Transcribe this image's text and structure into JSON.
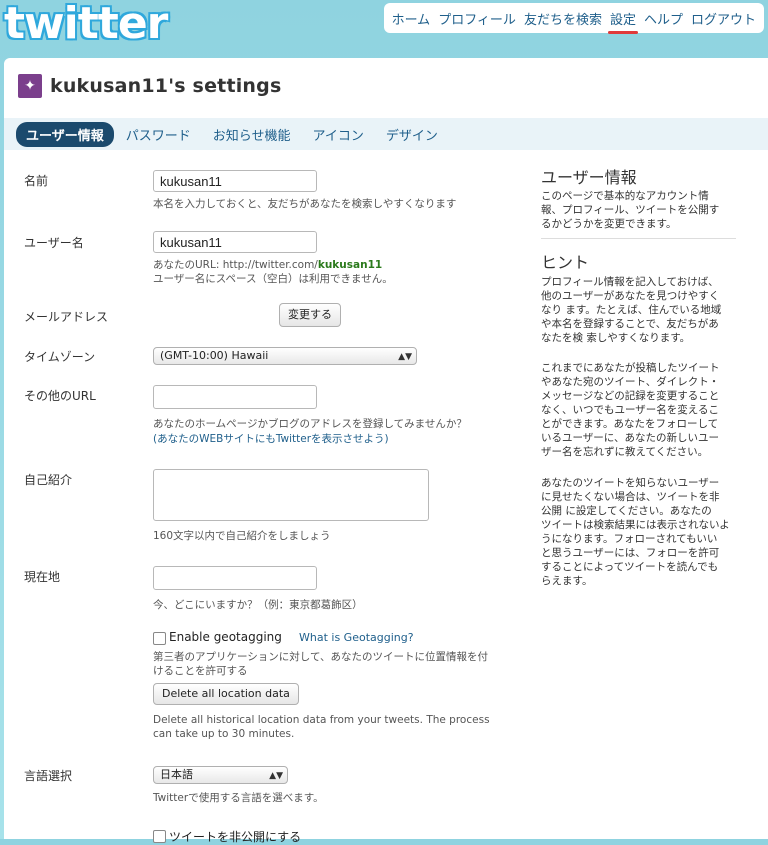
{
  "header": {
    "logo": "twitter",
    "nav": [
      "ホーム",
      "プロフィール",
      "友だちを検索",
      "設定",
      "ヘルプ",
      "ログアウト"
    ]
  },
  "page": {
    "title": "kukusan11's settings",
    "tabs": [
      "ユーザー情報",
      "パスワード",
      "お知らせ機能",
      "アイコン",
      "デザイン"
    ]
  },
  "form": {
    "name": {
      "label": "名前",
      "value": "kukusan11",
      "hint": "本名を入力しておくと、友だちがあなたを検索しやすくなります"
    },
    "username": {
      "label": "ユーザー名",
      "value": "kukusan11",
      "hint_prefix": "あなたのURL: http://twitter.com/",
      "hint_user": "kukusan11",
      "hint2": "ユーザー名にスペース（空白）は利用できません。"
    },
    "email": {
      "label": "メールアドレス",
      "button": "変更する"
    },
    "timezone": {
      "label": "タイムゾーン",
      "value": "(GMT-10:00) Hawaii"
    },
    "url": {
      "label": "その他のURL",
      "value": "",
      "hint": "あなたのホームページかブログのアドレスを登録してみませんか？",
      "link": "(あなたのWEBサイトにもTwitterを表示させよう)"
    },
    "bio": {
      "label": "自己紹介",
      "hint": "160文字以内で自己紹介をしましょう"
    },
    "location": {
      "label": "現在地",
      "value": "",
      "hint": "今、どこにいますか？（例：東京都葛飾区）"
    },
    "geotag": {
      "label": "Enable geotagging",
      "link": "What is Geotagging?",
      "hint1": "第三者のアプリケーションに対して、あなたのツイートに位置情報を付",
      "hint2": "けることを許可する",
      "delete_button": "Delete all location data",
      "delete_hint1": "Delete all historical location data from your tweets. The process",
      "delete_hint2": "can take up to 30 minutes."
    },
    "language": {
      "label": "言語選択",
      "value": "日本語",
      "hint": "Twitterで使用する言語を選べます。"
    },
    "private": {
      "label": "ツイートを非公開にする"
    }
  },
  "sidebar": {
    "h1": "ユーザー情報",
    "p1": [
      "このページで基本的なアカウント情",
      "報、プロフィール、ツイートを公開す",
      "るかどうかを変更できます。"
    ],
    "h2": "ヒント",
    "p2": [
      "プロフィール情報を記入しておけば、",
      "他のユーザーがあなたを見つけやすく",
      "なり ます。たとえば、住んでいる地域",
      "や本名を登録することで、友だちがあ",
      "なたを検 索しやすくなります。"
    ],
    "p3": [
      "これまでにあなたが投稿したツイート",
      "やあなた宛のツイート、ダイレクト・",
      "メッセージなどの記録を変更すること",
      "なく、いつでもユーザー名を変えるこ",
      "とができます。あなたをフォローして",
      "いるユーザーに、あなたの新しいユー",
      "ザー名を忘れずに教えてください。"
    ],
    "p4": [
      "あなたのツイートを知らないユーザー",
      "に見せたくない場合は、ツイートを非",
      "公開 に設定してください。あなたの",
      "ツイートは検索結果には表示されないよ",
      "うになります。フォローされてもいい",
      "と思うユーザーには、フォローを許可",
      "することによってツイートを読んでも",
      "らえます。"
    ]
  }
}
